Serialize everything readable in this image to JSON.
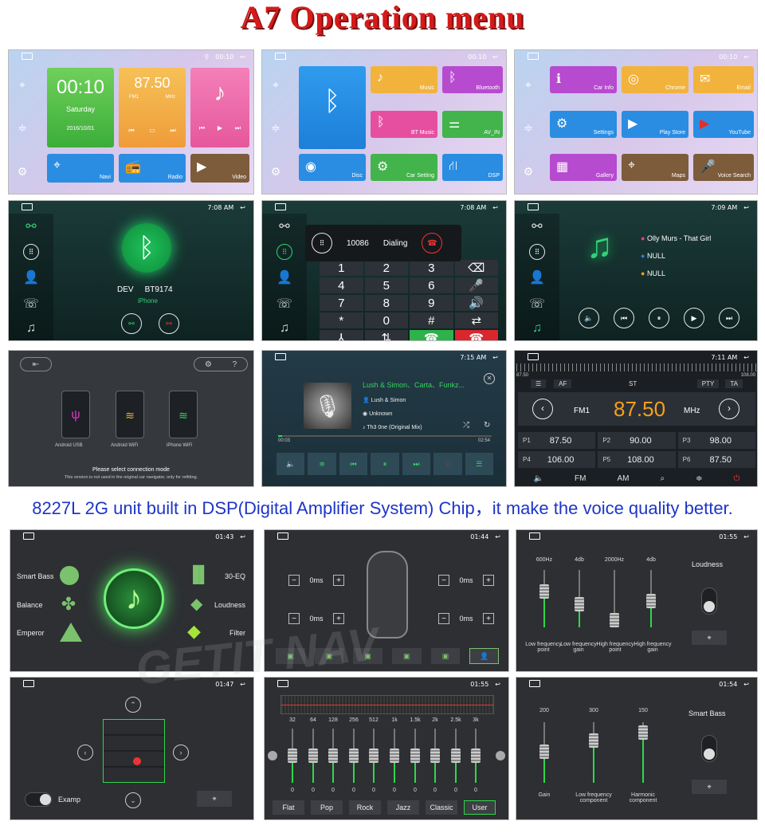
{
  "title": "A7  Operation menu",
  "caption": "8227L 2G unit built in DSP(Digital Amplifier System) Chip，it make the voice quality better.",
  "watermark": "GETIT NAV",
  "status": {
    "t1": "00:10",
    "t2": "7:08 AM",
    "t3": "7:09 AM",
    "t4": "7:15 AM",
    "t5": "7:11 AM",
    "d1": "01:43",
    "d2": "01:44",
    "d3": "01:55",
    "d4": "01:47",
    "d5": "01:55",
    "d6": "01:54"
  },
  "launcher1": {
    "clock": "00:10",
    "day": "Saturday",
    "date": "2016/10/01",
    "freq": "87.50",
    "fm": "FM1",
    "mhz": "MHz",
    "navi": "Navi",
    "radio": "Radio",
    "video": "Video"
  },
  "launcher2": {
    "music": "Music",
    "bluetooth": "Bluetooth",
    "btmusic": "BT Music",
    "avin": "AV_IN",
    "disc": "Disc",
    "carsetting": "Car Setting",
    "dsp": "DSP"
  },
  "launcher3": {
    "carinfo": "Car Info",
    "chrome": "Chrome",
    "email": "Email",
    "settings": "Settings",
    "playstore": "Play Store",
    "youtube": "YouTube",
    "gallery": "Gallery",
    "maps": "Maps",
    "voicesearch": "Voice Search"
  },
  "bt_connect": {
    "dev": "DEV",
    "name": "BT9174",
    "phone": "iPhone"
  },
  "dialing": {
    "number": "10086",
    "state": "Dialing",
    "keys": [
      "1",
      "2",
      "3",
      "⌫",
      "4",
      "5",
      "6",
      "🎤",
      "7",
      "8",
      "9",
      "🔊",
      "*",
      "0",
      "#",
      "⇄"
    ]
  },
  "bt_music": {
    "track": "Olly Murs - That Girl",
    "artist": "NULL",
    "album": "NULL"
  },
  "connect": {
    "title": "Please select connection mode",
    "note": "This version is not used in the original car navigator, only for refitting.",
    "usb": "Android USB",
    "wifi": "Android WiFi",
    "iphone": "iPhone WiFi"
  },
  "media": {
    "scroll": "Lush & Simon、Carta、Funkz...",
    "artist": "Lush & Simon",
    "album": "Unknown",
    "track": "Th3 0ne (Original Mix)",
    "elapsed": "00:03",
    "total": "02:54"
  },
  "radio": {
    "scale_start": "87.50",
    "scale_end": "108.00",
    "af": "AF",
    "st": "ST",
    "pty": "PTY",
    "ta": "TA",
    "band": "FM1",
    "freq": "87.50",
    "unit": "MHz",
    "presets": [
      {
        "n": "P1",
        "v": "87.50"
      },
      {
        "n": "P2",
        "v": "90.00"
      },
      {
        "n": "P3",
        "v": "98.00"
      },
      {
        "n": "P4",
        "v": "106.00"
      },
      {
        "n": "P5",
        "v": "108.00"
      },
      {
        "n": "P6",
        "v": "87.50"
      }
    ],
    "fm": "FM",
    "am": "AM"
  },
  "dsp_main": {
    "smart": "Smart Bass",
    "balance": "Balance",
    "emperor": "Emperor",
    "eq": "30-EQ",
    "loud": "Loudness",
    "filter": "Filter"
  },
  "delay": {
    "v": "0ms"
  },
  "loudness": {
    "bands": [
      "600Hz",
      "4db",
      "2000Hz",
      "4db"
    ],
    "labels": [
      "Low frequency point",
      "Low frequency gain",
      "High frequency point",
      "High frequency gain"
    ],
    "title": "Loudness"
  },
  "balance": {
    "examp": "Examp"
  },
  "eq": {
    "bands": [
      "32",
      "64",
      "128",
      "256",
      "512",
      "1k",
      "1.5k",
      "2k",
      "2.5k",
      "3k"
    ],
    "vals": [
      "0",
      "0",
      "0",
      "0",
      "0",
      "0",
      "0",
      "0",
      "0",
      "0"
    ],
    "presets": [
      "Flat",
      "Pop",
      "Rock",
      "Jazz",
      "Classic",
      "User"
    ]
  },
  "smartbass": {
    "nums": [
      "200",
      "300",
      "150"
    ],
    "labels": [
      "Gain",
      "Low frequency component",
      "Harmonic component"
    ],
    "title": "Smart Bass"
  }
}
